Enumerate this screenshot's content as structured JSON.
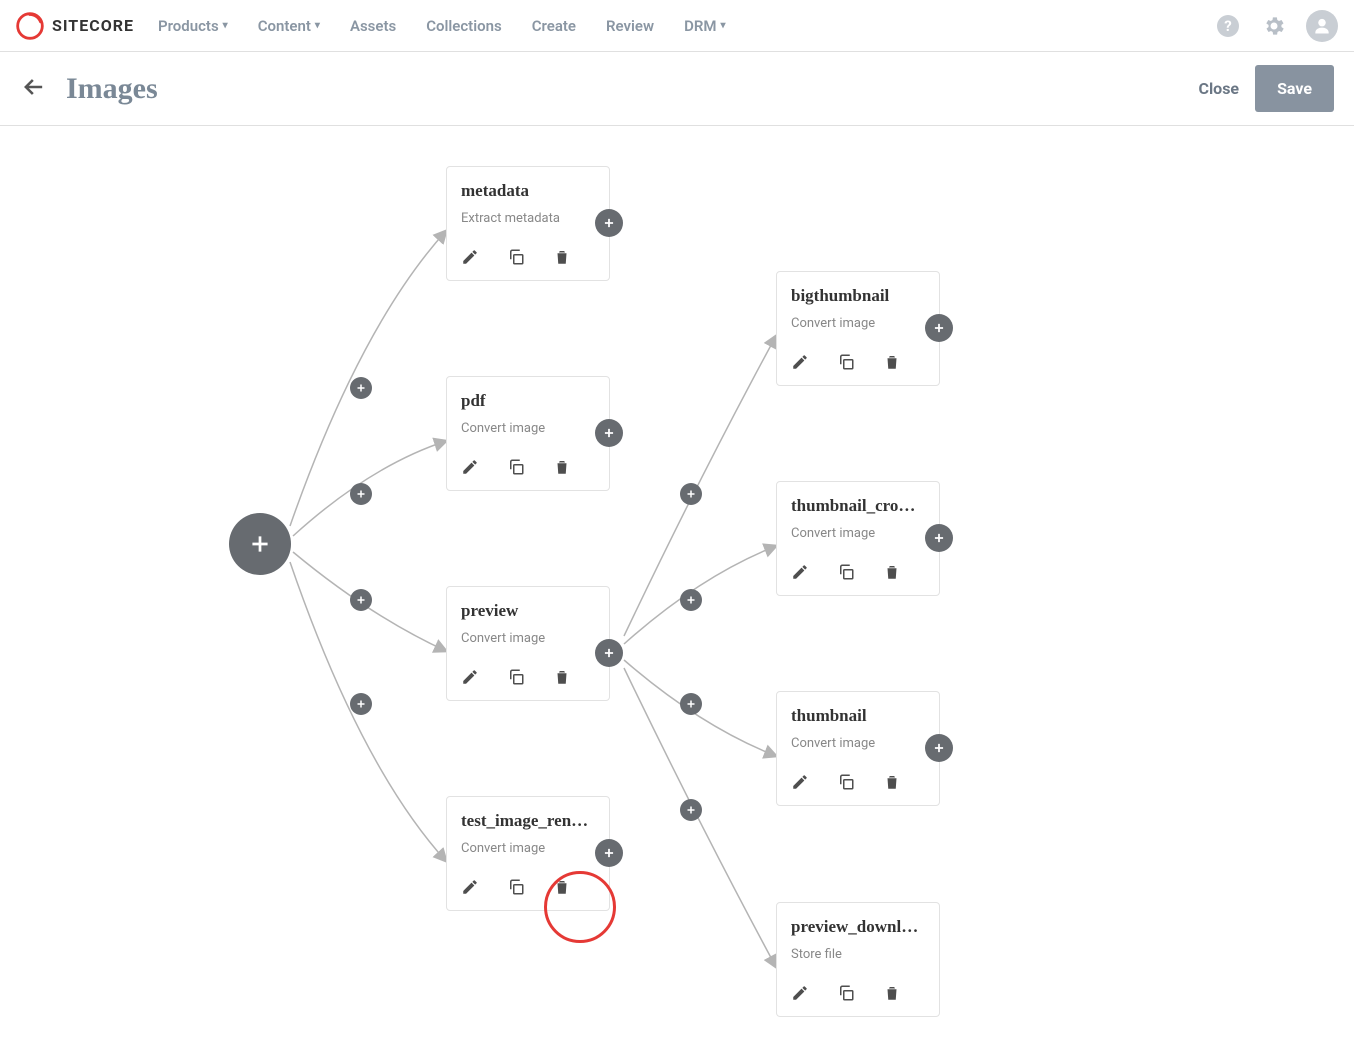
{
  "brand": {
    "name": "SITECORE"
  },
  "nav": {
    "products": "Products",
    "content": "Content",
    "assets": "Assets",
    "collections": "Collections",
    "create": "Create",
    "review": "Review",
    "drm": "DRM"
  },
  "page": {
    "title": "Images",
    "close": "Close",
    "save": "Save"
  },
  "nodes": {
    "metadata": {
      "title": "metadata",
      "subtitle": "Extract metadata"
    },
    "pdf": {
      "title": "pdf",
      "subtitle": "Convert image"
    },
    "preview": {
      "title": "preview",
      "subtitle": "Convert image"
    },
    "testimg": {
      "title": "test_image_ren…",
      "subtitle": "Convert image"
    },
    "bigthumb": {
      "title": "bigthumbnail",
      "subtitle": "Convert image"
    },
    "thumbcrop": {
      "title": "thumbnail_cro…",
      "subtitle": "Convert image"
    },
    "thumbnail": {
      "title": "thumbnail",
      "subtitle": "Convert image"
    },
    "prevdl": {
      "title": "preview_downl…",
      "subtitle": "Store file"
    }
  }
}
